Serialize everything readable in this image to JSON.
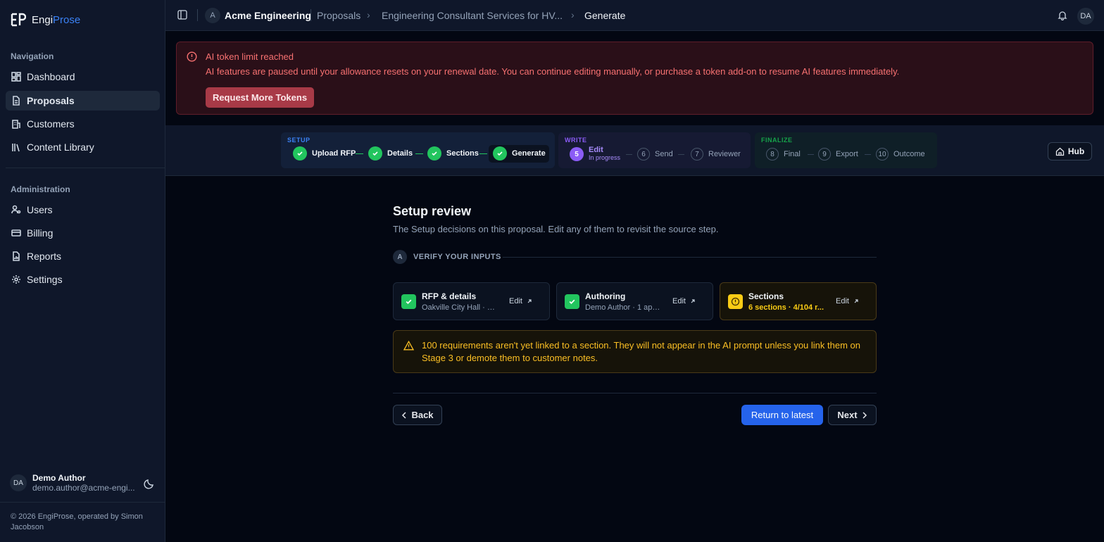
{
  "app": {
    "logo_prefix": "Engi",
    "logo_suffix": "Prose"
  },
  "sidebar": {
    "nav_heading": "Navigation",
    "nav_items": [
      {
        "label": "Dashboard",
        "icon": "dashboard-icon"
      },
      {
        "label": "Proposals",
        "icon": "document-icon",
        "active": true
      },
      {
        "label": "Customers",
        "icon": "building-icon"
      },
      {
        "label": "Content Library",
        "icon": "library-icon"
      }
    ],
    "admin_heading": "Administration",
    "admin_items": [
      {
        "label": "Users",
        "icon": "users-icon"
      },
      {
        "label": "Billing",
        "icon": "credit-card-icon"
      },
      {
        "label": "Reports",
        "icon": "report-icon"
      },
      {
        "label": "Settings",
        "icon": "gear-icon"
      }
    ],
    "user": {
      "initials": "DA",
      "name": "Demo Author",
      "email": "demo.author@acme-engi..."
    },
    "copyright": "© 2026 EngiProse, operated by Simon Jacobson"
  },
  "topbar": {
    "org_initial": "A",
    "org_name": "Acme Engineering",
    "breadcrumbs": [
      "Proposals",
      "Engineering Consultant Services for HV...",
      "Generate"
    ],
    "user_initials": "DA"
  },
  "alert": {
    "title": "AI token limit reached",
    "body": "AI features are paused until your allowance resets on your renewal date. You can continue editing manually, or purchase a token add-on to resume AI features immediately.",
    "button": "Request More Tokens",
    "color": "#f87171"
  },
  "stepper": {
    "groups": [
      {
        "label": "SETUP",
        "color": "#3b82f6"
      },
      {
        "label": "WRITE",
        "color": "#8b5cf6"
      },
      {
        "label": "FINALIZE",
        "color": "#16a34a"
      }
    ],
    "setup_steps": [
      "Upload RFP",
      "Details",
      "Sections",
      "Generate"
    ],
    "write_current": {
      "num": "5",
      "label": "Edit",
      "status": "In progress"
    },
    "write_steps": [
      {
        "num": "6",
        "label": "Send"
      },
      {
        "num": "7",
        "label": "Reviewer"
      }
    ],
    "finalize_steps": [
      {
        "num": "8",
        "label": "Final"
      },
      {
        "num": "9",
        "label": "Export"
      },
      {
        "num": "10",
        "label": "Outcome"
      }
    ],
    "hub_label": "Hub"
  },
  "main": {
    "title": "Setup review",
    "subtitle": "The Setup decisions on this proposal. Edit any of them to revisit the source step.",
    "section_badge": "A",
    "section_label": "VERIFY YOUR INPUTS",
    "cards": [
      {
        "title": "RFP & details",
        "sub": "Oakville City Hall · D...",
        "edit": "Edit",
        "status": "done"
      },
      {
        "title": "Authoring",
        "sub": "Demo Author · 1 app...",
        "edit": "Edit",
        "status": "done"
      },
      {
        "title": "Sections",
        "sub": "6 sections · 4/104 r...",
        "edit": "Edit",
        "status": "warning"
      }
    ],
    "warning": "100 requirements aren't yet linked to a section. They will not appear in the AI prompt unless you link them on Stage 3 or demote them to customer notes.",
    "back_label": "Back",
    "return_label": "Return to latest",
    "next_label": "Next",
    "accent": "#2563eb",
    "success": "#22c55e",
    "warning_color": "#fbbf24"
  }
}
